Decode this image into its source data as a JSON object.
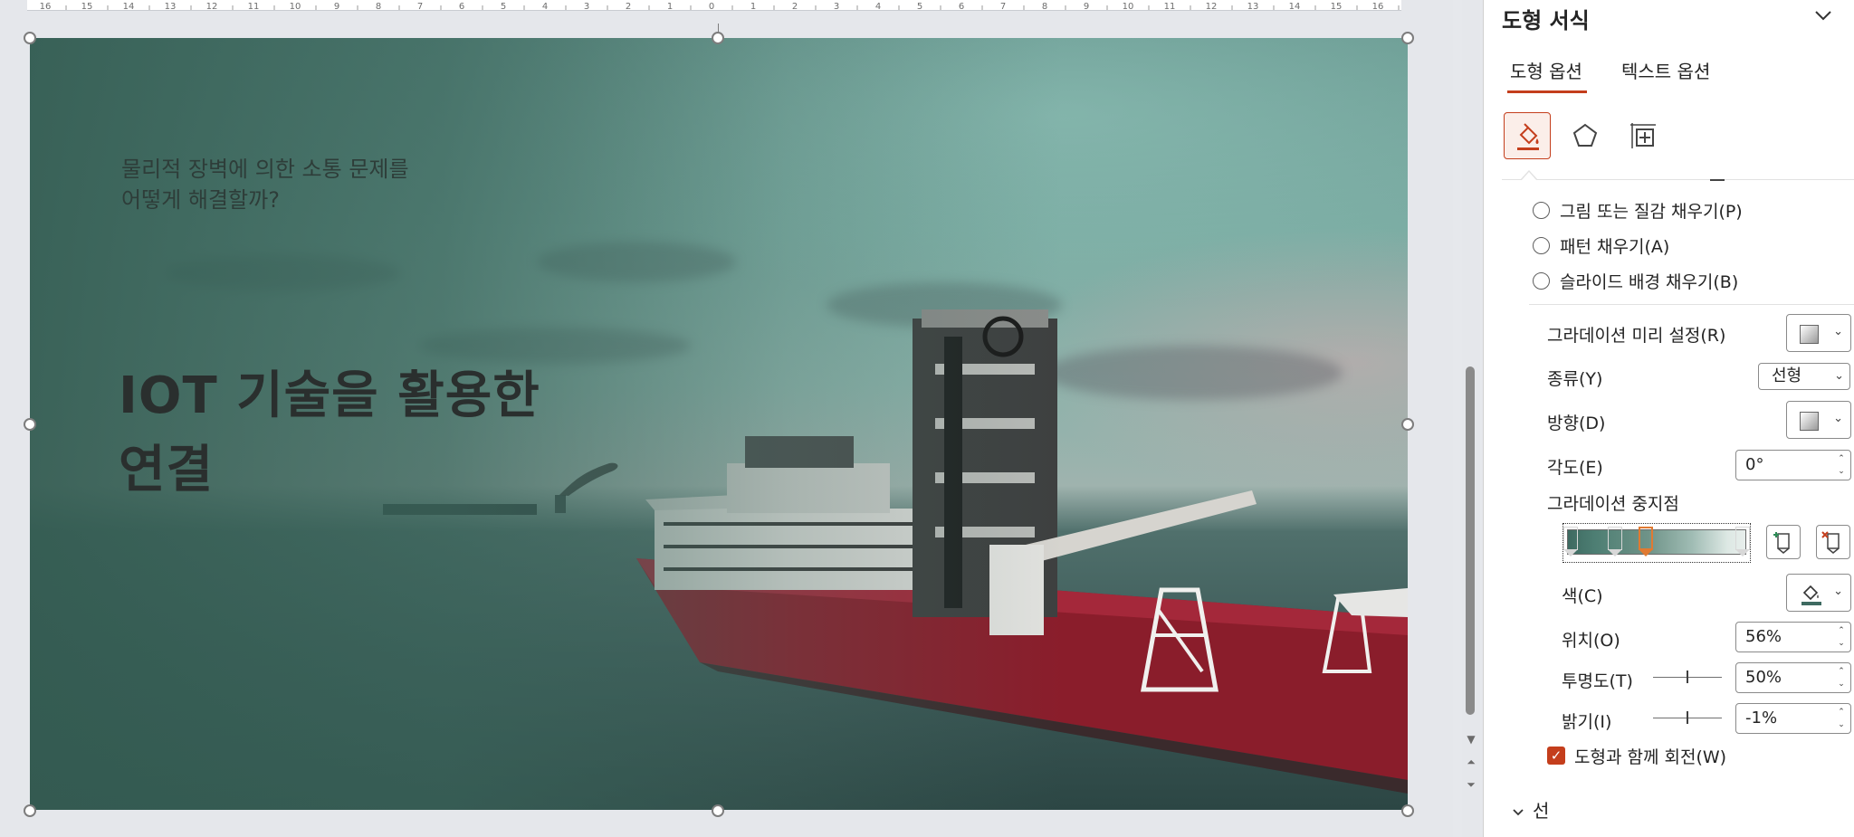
{
  "slide": {
    "subtitle_line1": "물리적 장벽에 의한 소통 문제를",
    "subtitle_line2": "어떻게 해결할까?",
    "title_line1": "IOT 기술을 활용한",
    "title_line2": "연결"
  },
  "ruler": {
    "labels": [
      "16",
      "15",
      "14",
      "13",
      "12",
      "11",
      "10",
      "9",
      "8",
      "7",
      "6",
      "5",
      "4",
      "3",
      "2",
      "1",
      "0",
      "1",
      "2",
      "3",
      "4",
      "5",
      "6",
      "7",
      "8",
      "9",
      "10",
      "11",
      "12",
      "13",
      "14",
      "15",
      "16"
    ]
  },
  "pane": {
    "title": "도형 서식",
    "tabs": [
      {
        "label": "도형 옵션",
        "active": true
      },
      {
        "label": "텍스트 옵션",
        "active": false
      }
    ],
    "category_icons": [
      "fill-line-icon",
      "effects-pentagon-icon",
      "size-properties-icon"
    ],
    "fill_options": [
      {
        "label": "그림 또는 질감 채우기(P)"
      },
      {
        "label": "패턴 채우기(A)"
      },
      {
        "label": "슬라이드 배경 채우기(B)"
      }
    ],
    "gradient": {
      "preset_label": "그라데이션 미리 설정(R)",
      "type_label": "종류(Y)",
      "type_value": "선형",
      "direction_label": "방향(D)",
      "angle_label": "각도(E)",
      "angle_value": "0°",
      "stops_label": "그라데이션 중지점",
      "stops": [
        {
          "position": 0.02,
          "selected": false
        },
        {
          "position": 0.27,
          "selected": false
        },
        {
          "position": 0.44,
          "selected": true
        },
        {
          "position": 0.98,
          "selected": false
        }
      ],
      "color_label": "색(C)",
      "position_label": "위치(O)",
      "position_value": "56%",
      "transparency_label": "투명도(T)",
      "transparency_value": "50%",
      "transparency_level": 0.5,
      "brightness_label": "밝기(I)",
      "brightness_value": "-1%",
      "brightness_level": 0.5,
      "rotate_with_shape_label": "도형과 함께 회전(W)",
      "rotate_with_shape_checked": true
    },
    "line_section_label": "선",
    "colors": {
      "accent": "#c43e1c",
      "selected_stop": "#e07a32"
    }
  }
}
